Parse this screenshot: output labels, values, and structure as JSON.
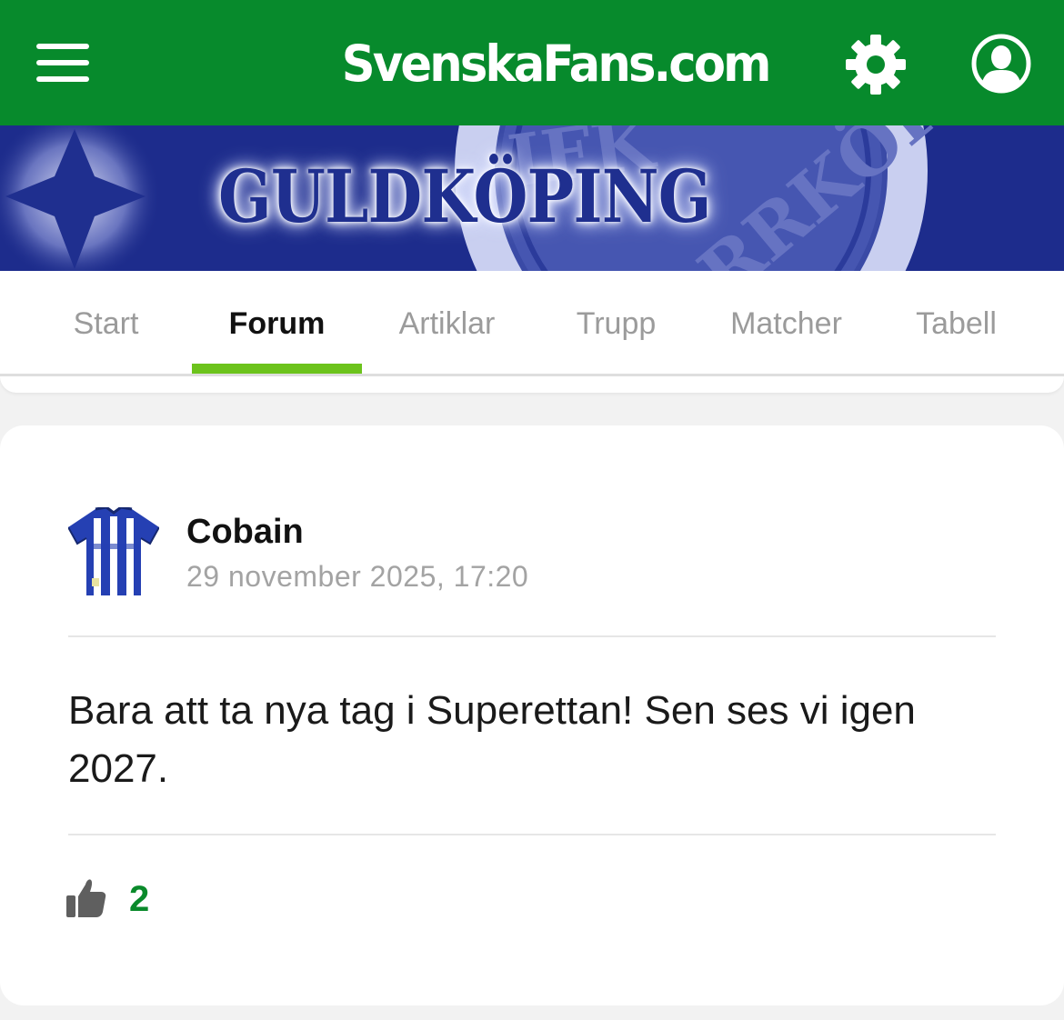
{
  "header": {
    "logo_text": "SvenskaFans.com",
    "menu_icon": "hamburger-menu-icon",
    "settings_icon": "gear-icon",
    "profile_icon": "user-profile-icon",
    "bg_color": "#078a2c"
  },
  "banner": {
    "title": "GULDKÖPING",
    "emblem_text": "IFK NORRKÖPING",
    "bg_color": "#1d2c8c"
  },
  "tabs": [
    {
      "label": "Start"
    },
    {
      "label": "Forum"
    },
    {
      "label": "Artiklar"
    },
    {
      "label": "Trupp"
    },
    {
      "label": "Matcher"
    },
    {
      "label": "Tabell"
    }
  ],
  "active_tab": "Forum",
  "accent_color": "#6cc31c",
  "post": {
    "author": "Cobain",
    "timestamp": "29 november 2025, 17:20",
    "avatar_icon": "team-jersey-icon",
    "body": "Bara att ta nya tag i Superettan! Sen ses vi igen 2027.",
    "likes": "2",
    "like_icon": "thumbs-up-icon"
  }
}
